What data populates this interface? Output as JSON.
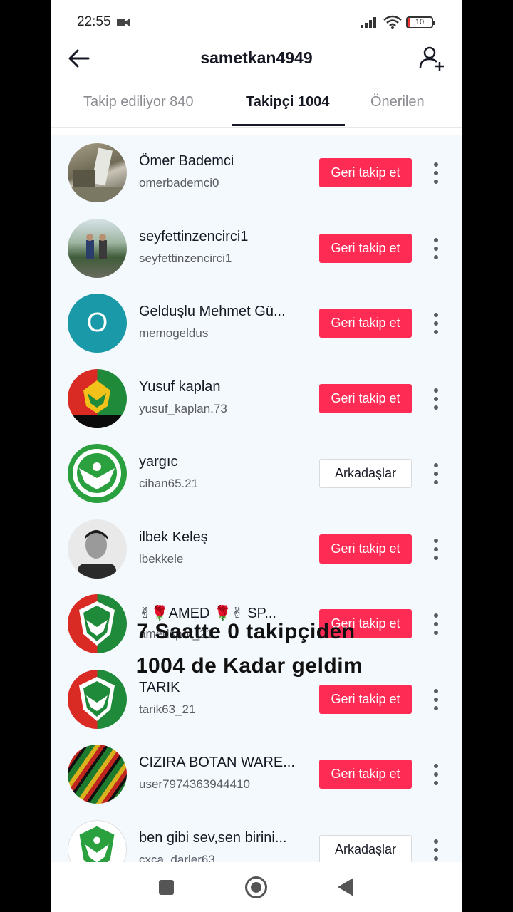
{
  "status": {
    "time": "22:55",
    "battery": "10"
  },
  "header": {
    "title": "sametkan4949"
  },
  "tabs": [
    {
      "label": "Takip ediliyor 840"
    },
    {
      "label": "Takipçi 1004",
      "active": true
    },
    {
      "label": "Önerilen"
    }
  ],
  "followers": [
    {
      "name": "Ömer Bademci",
      "handle": "omerbademci0",
      "button": "Geri takip et",
      "avatar": "photo"
    },
    {
      "name": "seyfettinzencirci1",
      "handle": "seyfettinzencirci1",
      "button": "Geri takip et",
      "avatar": "photo"
    },
    {
      "name": "Gelduşlu Mehmet Gü...",
      "handle": "memogeldus",
      "button": "Geri takip et",
      "avatar_letter": "O",
      "avatar_color": "#1a9aa8"
    },
    {
      "name": "Yusuf kaplan",
      "handle": "yusuf_kaplan.73",
      "button": "Geri takip et",
      "avatar": "amedspor-logo-red-green"
    },
    {
      "name": "yargıc",
      "handle": "cihan65.21",
      "button": "Arkadaşlar",
      "avatar": "amedspor-logo-green"
    },
    {
      "name": "ilbek Keleş",
      "handle": "lbekkele",
      "button": "Geri takip et",
      "avatar": "photo"
    },
    {
      "name": "✌🌹AMED 🌹✌ SP...",
      "handle": "amedspor_21",
      "button": "Geri takip et",
      "avatar": "amedspor-logo-red-green"
    },
    {
      "name": "TARIK",
      "handle": "tarik63_21",
      "button": "Geri takip et",
      "avatar": "amedspor-logo-red-green"
    },
    {
      "name": "CIZIRA BOTAN WARE...",
      "handle": "user7974363944410",
      "button": "Geri takip et",
      "avatar": "photo"
    },
    {
      "name": "ben gibi sev,sen birini...",
      "handle": "cxca_darler63",
      "button": "Arkadaşlar",
      "avatar": "amedspor-logo-green"
    }
  ],
  "overlay": {
    "line1": "7 Saatte 0 takipçiden",
    "line2": "1004 de Kadar geldim"
  },
  "colors": {
    "accent": "#fe2c55"
  }
}
